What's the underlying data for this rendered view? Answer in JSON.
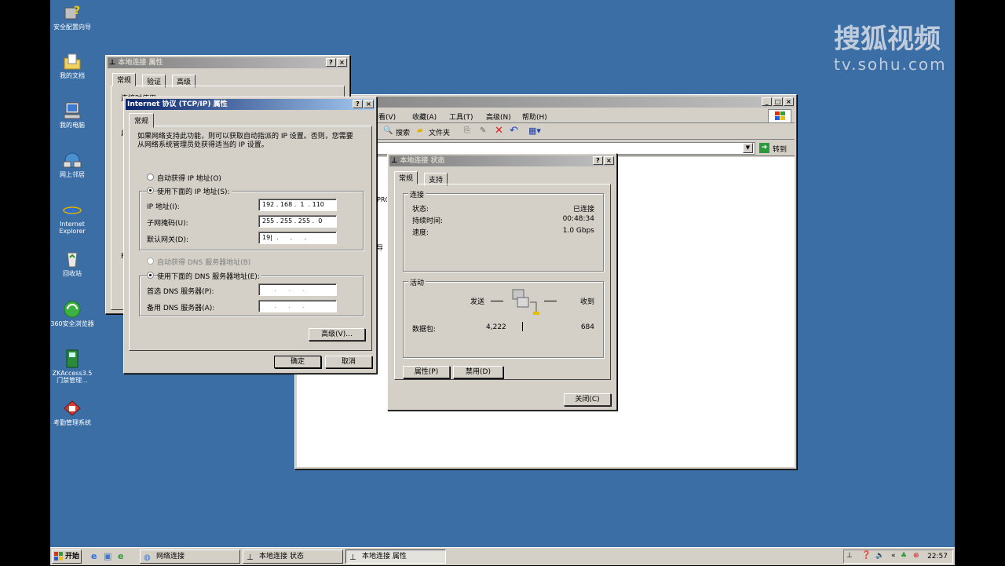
{
  "desktop_icons": [
    {
      "label": "安全配置向导",
      "icon": "security-wizard-icon"
    },
    {
      "label": "我的文档",
      "icon": "my-documents-icon"
    },
    {
      "label": "我的电脑",
      "icon": "my-computer-icon"
    },
    {
      "label": "网上邻居",
      "icon": "network-places-icon"
    },
    {
      "label": "Internet Explorer",
      "icon": "internet-explorer-icon"
    },
    {
      "label": "回收站",
      "icon": "recycle-bin-icon"
    },
    {
      "label": "360安全浏览器",
      "icon": "360-browser-icon"
    },
    {
      "label": "ZKAccess3.5 门禁管理...",
      "icon": "zkaccess-icon"
    },
    {
      "label": "考勤管理系统",
      "icon": "attendance-system-icon"
    }
  ],
  "watermark": {
    "brand": "搜狐视频",
    "url": "tv.sohu.com"
  },
  "props_window": {
    "title": "本地连接 属性",
    "tabs": [
      "常规",
      "验证",
      "高级"
    ],
    "partial_text_1": "连接时使用",
    "partial_text_2": "此",
    "partial_text_3": "F"
  },
  "tcpip_dialog": {
    "title": "Internet 协议 (TCP/IP) 属性",
    "tab": "常规",
    "description": "如果网络支持此功能，则可以获取自动指派的 IP 设置。否则，您需要从网络系统管理员处获得适当的 IP 设置。",
    "auto_ip_label": "自动获得 IP 地址(O)",
    "manual_ip_label": "使用下面的 IP 地址(S):",
    "ip_label": "IP 地址(I):",
    "ip_value": "192 . 168 .  1  . 110",
    "mask_label": "子网掩码(U):",
    "mask_value": "255 . 255 . 255 .  0",
    "gateway_label": "默认网关(D):",
    "gateway_value": "19|  .      .      .",
    "auto_dns_label": "自动获得 DNS 服务器地址(B)",
    "manual_dns_label": "使用下面的 DNS 服务器地址(E):",
    "pref_dns_label": "首选 DNS 服务器(P):",
    "alt_dns_label": "备用 DNS 服务器(A):",
    "empty_ip": "      .      .      .",
    "advanced_button": "高级(V)...",
    "ok_button": "确定",
    "cancel_button": "取消"
  },
  "explorer": {
    "menu": [
      "查看(V)",
      "收藏(A)",
      "工具(T)",
      "高级(N)",
      "帮助(H)"
    ],
    "search_label": "搜索",
    "folders_label": "文件夹",
    "go_label": "转到",
    "partial_left_1": "PRO",
    "partial_left_2": "导"
  },
  "status_window": {
    "title": "本地连接 状态",
    "tabs": [
      "常规",
      "支持"
    ],
    "connection_group": "连接",
    "status_label": "状态:",
    "status_value": "已连接",
    "duration_label": "持续时间:",
    "duration_value": "00:48:34",
    "speed_label": "速度:",
    "speed_value": "1.0 Gbps",
    "activity_group": "活动",
    "sent_label": "发送",
    "received_label": "收到",
    "packets_label": "数据包:",
    "packets_sent": "4,222",
    "packets_received": "684",
    "properties_button": "属性(P)",
    "disable_button": "禁用(D)",
    "close_button": "关闭(C)"
  },
  "taskbar": {
    "start_label": "开始",
    "tasks": [
      "网络连接",
      "本地连接 状态",
      "本地连接 属性"
    ],
    "clock": "22:57"
  },
  "colors": {
    "desktop": "#3a6ea5",
    "title_active": "#0a246a",
    "face": "#d4d0c8"
  }
}
